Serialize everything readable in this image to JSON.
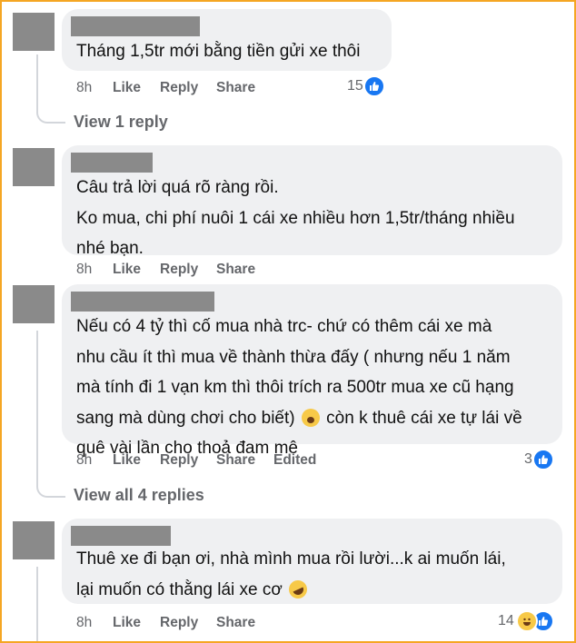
{
  "comments": [
    {
      "lines": [
        "Tháng 1,5tr mới bằng tiền gửi xe thôi"
      ],
      "time": "8h",
      "like": "Like",
      "reply": "Reply",
      "share": "Share",
      "reaction_count": "15",
      "replies_link": "View 1 reply"
    },
    {
      "lines": [
        "Câu trả lời quá rõ ràng rồi.",
        "Ko mua, chi phí nuôi 1 cái xe nhiều hơn 1,5tr/tháng nhiều",
        "nhé bạn."
      ],
      "time": "8h",
      "like": "Like",
      "reply": "Reply",
      "share": "Share"
    },
    {
      "lines": [
        "Nếu có 4 tỷ thì cố mua nhà trc- chứ có thêm cái xe mà",
        "nhu cầu ít thì mua về thành thừa đấy ( nhưng nếu 1 năm",
        "mà tính đi 1 vạn km thì thôi trích ra 500tr mua xe cũ hạng",
        "sang mà dùng chơi cho biết)",
        "còn k thuê cái xe tự lái về",
        "quê vài lần cho thoả đam mê"
      ],
      "time": "8h",
      "like": "Like",
      "reply": "Reply",
      "share": "Share",
      "edited": "Edited",
      "reaction_count": "3",
      "replies_link": "View all 4 replies"
    },
    {
      "lines": [
        "Thuê xe đi bạn ơi, nhà mình mua rồi lười...k ai muốn lái,",
        "lại muốn có thằng lái xe cơ"
      ],
      "time": "8h",
      "like": "Like",
      "reply": "Reply",
      "share": "Share",
      "reaction_count": "14"
    }
  ],
  "colors": {
    "bubble": "#eff0f2",
    "meta_text": "#65676b",
    "like_blue": "#1877f2",
    "frame_border": "#f5a623",
    "avatar_placeholder": "#8a8a8a"
  },
  "icons": [
    "like-reaction-icon",
    "haha-reaction-icon",
    "shocked-emoji-icon",
    "rofl-emoji-icon"
  ]
}
